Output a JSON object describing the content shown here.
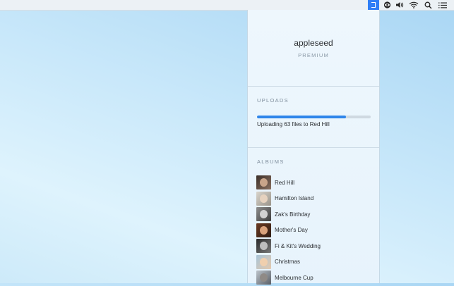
{
  "menubar": {
    "icons": [
      "app-icon",
      "eye-icon",
      "volume-icon",
      "wifi-icon",
      "search-icon",
      "list-icon"
    ]
  },
  "account": {
    "name": "appleseed",
    "tier": "PREMIUM"
  },
  "uploads": {
    "title": "UPLOADS",
    "progress_percent": 78,
    "status": "Uploading 63 files to Red Hill"
  },
  "albums": {
    "title": "ALBUMS",
    "items": [
      {
        "label": "Red Hill"
      },
      {
        "label": "Hamilton Island"
      },
      {
        "label": "Zak's Birthday"
      },
      {
        "label": "Mother's Day"
      },
      {
        "label": "Fi & Kit's Wedding"
      },
      {
        "label": "Christmas"
      },
      {
        "label": "Melbourne Cup"
      }
    ]
  },
  "colors": {
    "accent": "#2f86ea",
    "menubar_highlight": "#2f7ef6"
  }
}
